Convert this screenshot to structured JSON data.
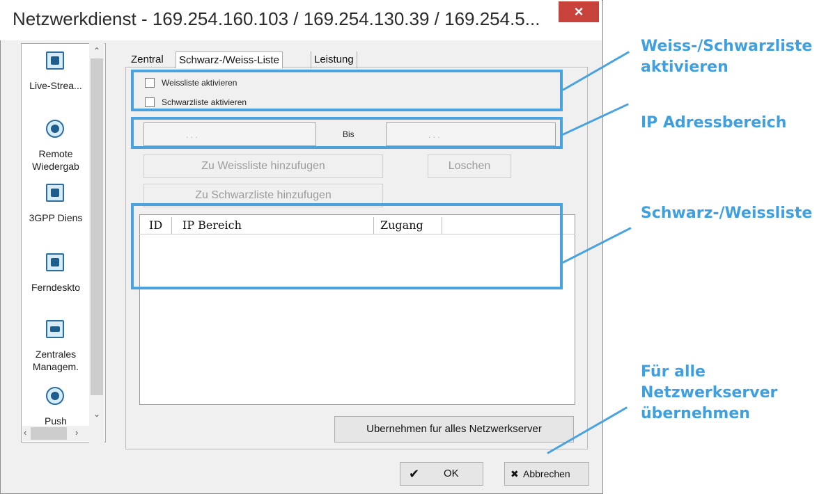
{
  "window": {
    "title": "Netzwerkdienst - 169.254.160.103 / 169.254.130.39 / 169.254.5...",
    "close_label": "×"
  },
  "sidebar": {
    "items": [
      {
        "icon": "monitor-icon",
        "label": "Live-Strea..."
      },
      {
        "icon": "playback-icon",
        "label": "Remote\nWiedergab"
      },
      {
        "icon": "phone-icon",
        "label": "3GPP Diens"
      },
      {
        "icon": "remote-desktop-icon",
        "label": "Ferndeskto"
      },
      {
        "icon": "keyboard-icon",
        "label": "Zentrales\nManagem."
      },
      {
        "icon": "push-icon",
        "label": "Push"
      }
    ]
  },
  "tabs": [
    {
      "label": "Zentral",
      "active": false
    },
    {
      "label": "Schwarz-/Weiss-Liste",
      "active": true
    },
    {
      "label": "Leistung",
      "active": false
    }
  ],
  "panel": {
    "whitelist_checkbox": {
      "label": "Weissliste aktivieren",
      "checked": false
    },
    "blacklist_checkbox": {
      "label": "Schwarzliste aktivieren",
      "checked": false
    },
    "range_to_label": "Bis",
    "ip_placeholder": ".       .       .",
    "add_whitelist_button": "Zu Weissliste hinzufugen",
    "delete_button": "Loschen",
    "add_blacklist_button": "Zu Schwarzliste hinzufugen",
    "table": {
      "columns": [
        "ID",
        "IP Bereich",
        "Zugang"
      ],
      "rows": []
    },
    "apply_all_button": "Ubernehmen fur alles Netzwerkserver"
  },
  "footer": {
    "ok_label": "OK",
    "cancel_label": "Abbrechen",
    "ok_icon": "✔",
    "cancel_icon": "✖"
  },
  "annotations": {
    "a1": "Weiss-/Schwarzliste\naktivieren",
    "a2": "IP Adressbereich",
    "a3": "Schwarz-/Weissliste",
    "a4": "Für alle\nNetzwerkserver\nübernehmen"
  },
  "colors": {
    "annotation": "#4aa3df",
    "close_button": "#c7423a"
  }
}
